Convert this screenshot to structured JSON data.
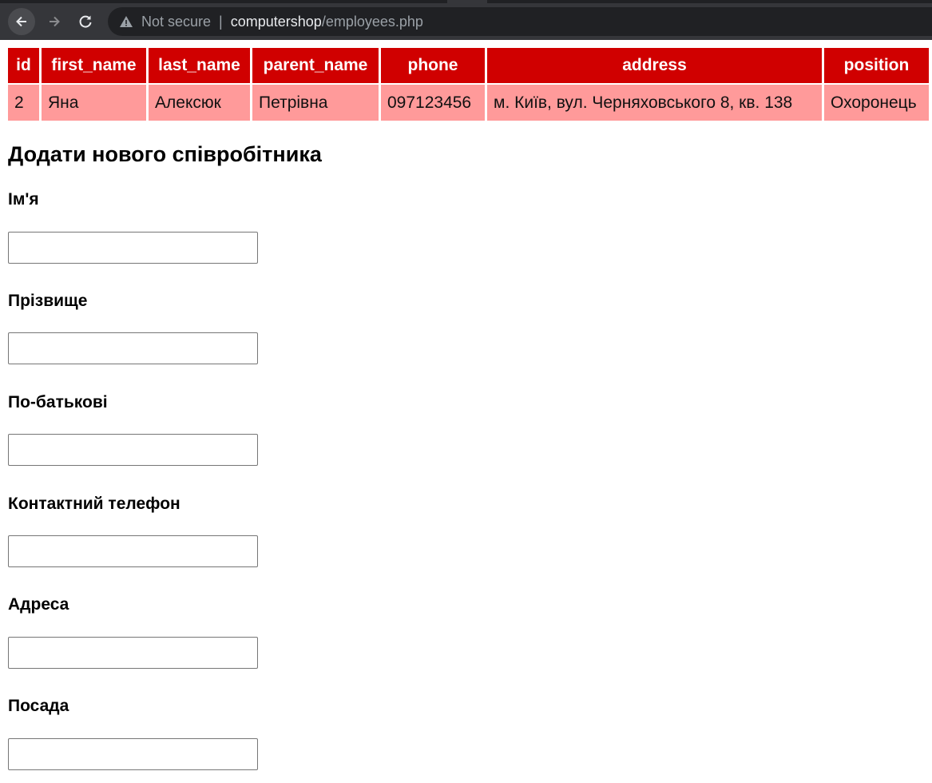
{
  "browser": {
    "security_label": "Not secure",
    "separator": "|",
    "url_host": "computershop",
    "url_path": "/employees.php",
    "icons": [
      "back-arrow-icon",
      "forward-arrow-icon",
      "reload-icon",
      "warning-icon"
    ]
  },
  "table": {
    "columns": [
      "id",
      "first_name",
      "last_name",
      "parent_name",
      "phone",
      "address",
      "position"
    ],
    "rows": [
      [
        "2",
        "Яна",
        "Алексюк",
        "Петрівна",
        "097123456",
        "м. Київ, вул. Черняховського 8, кв. 138",
        "Охоронець"
      ]
    ],
    "header_color": "#d00000",
    "row_color": "#ff9a9a"
  },
  "form": {
    "title": "Додати нового співробітника",
    "fields": [
      {
        "label": "Ім'я",
        "value": ""
      },
      {
        "label": "Прізвище",
        "value": ""
      },
      {
        "label": "По-батькові",
        "value": ""
      },
      {
        "label": "Контактний телефон",
        "value": ""
      },
      {
        "label": "Адреса",
        "value": ""
      },
      {
        "label": "Посада",
        "value": ""
      }
    ]
  }
}
